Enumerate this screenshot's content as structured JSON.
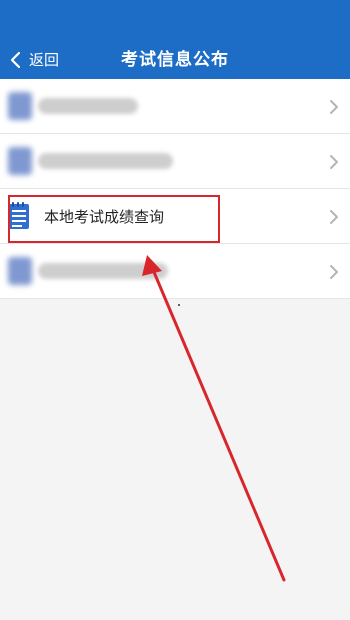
{
  "nav": {
    "back_label": "返回",
    "title": "考试信息公布"
  },
  "list": {
    "items": [
      {
        "label": "",
        "icon": "blurred-icon",
        "blurred": true
      },
      {
        "label": "",
        "icon": "blurred-icon",
        "blurred": true
      },
      {
        "label": "本地考试成绩查询",
        "icon": "notepad-icon",
        "blurred": false,
        "highlighted": true
      },
      {
        "label": "",
        "icon": "blurred-icon",
        "blurred": true
      }
    ]
  },
  "colors": {
    "nav_bg": "#1d6cc6",
    "highlight": "#d8272c",
    "icon_blue": "#2f6fd0"
  }
}
